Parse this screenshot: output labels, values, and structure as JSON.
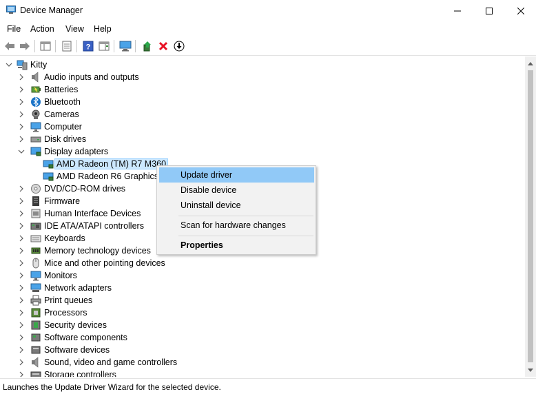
{
  "window": {
    "title": "Device Manager",
    "minimize_glyph": "—",
    "close_glyph": "✕"
  },
  "menu": [
    "File",
    "Action",
    "View",
    "Help"
  ],
  "tree": {
    "root": "Kitty",
    "categories": [
      {
        "label": "Audio inputs and outputs",
        "icon": "speaker-icon"
      },
      {
        "label": "Batteries",
        "icon": "battery-icon"
      },
      {
        "label": "Bluetooth",
        "icon": "bluetooth-icon"
      },
      {
        "label": "Cameras",
        "icon": "camera-icon"
      },
      {
        "label": "Computer",
        "icon": "computer-icon"
      },
      {
        "label": "Disk drives",
        "icon": "disk-drive-icon"
      },
      {
        "label": "Display adapters",
        "icon": "display-adapter-icon",
        "expanded": true,
        "children": [
          "AMD Radeon (TM) R7 M360",
          "AMD Radeon R6 Graphics"
        ]
      },
      {
        "label": "DVD/CD-ROM drives",
        "icon": "dvd-icon"
      },
      {
        "label": "Firmware",
        "icon": "firmware-icon"
      },
      {
        "label": "Human Interface Devices",
        "icon": "hid-icon"
      },
      {
        "label": "IDE ATA/ATAPI controllers",
        "icon": "ide-icon"
      },
      {
        "label": "Keyboards",
        "icon": "keyboard-icon"
      },
      {
        "label": "Memory technology devices",
        "icon": "memory-icon"
      },
      {
        "label": "Mice and other pointing devices",
        "icon": "mouse-icon"
      },
      {
        "label": "Monitors",
        "icon": "monitor-icon"
      },
      {
        "label": "Network adapters",
        "icon": "network-icon"
      },
      {
        "label": "Print queues",
        "icon": "printer-icon"
      },
      {
        "label": "Processors",
        "icon": "processor-icon"
      },
      {
        "label": "Security devices",
        "icon": "security-icon"
      },
      {
        "label": "Software components",
        "icon": "software-component-icon"
      },
      {
        "label": "Software devices",
        "icon": "software-device-icon"
      },
      {
        "label": "Sound, video and game controllers",
        "icon": "sound-icon"
      },
      {
        "label": "Storage controllers",
        "icon": "storage-icon"
      }
    ]
  },
  "context_menu": {
    "items": [
      "Update driver",
      "Disable device",
      "Uninstall device",
      "Scan for hardware changes",
      "Properties"
    ]
  },
  "status": {
    "text": "Launches the Update Driver Wizard for the selected device."
  },
  "colors": {
    "selection": "#cce8ff",
    "menu_hover": "#91c9f7",
    "accent_blue": "#1a73c7",
    "delete_red": "#e81123"
  }
}
